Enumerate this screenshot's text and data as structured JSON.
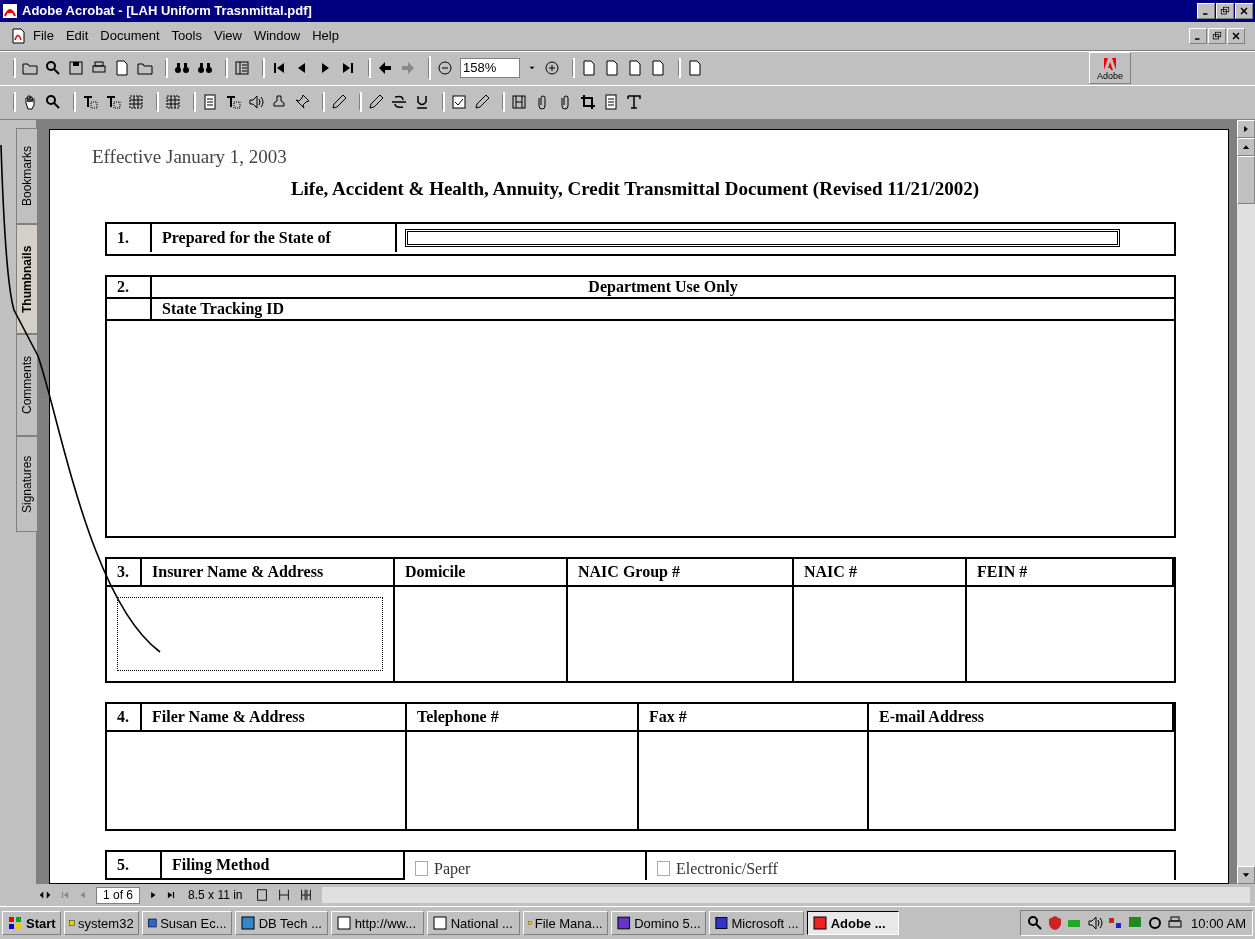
{
  "window": {
    "title": "Adobe Acrobat - [LAH Uniform Trasnmittal.pdf]"
  },
  "menu": [
    "File",
    "Edit",
    "Document",
    "Tools",
    "View",
    "Window",
    "Help"
  ],
  "toolbar": {
    "zoom": "158%",
    "logo_text": "Adobe"
  },
  "side_tabs": [
    {
      "label": "Bookmarks",
      "selected": false
    },
    {
      "label": "Thumbnails",
      "selected": true
    },
    {
      "label": "Comments",
      "selected": false
    },
    {
      "label": "Signatures",
      "selected": false
    }
  ],
  "document": {
    "effective": "Effective January 1, 2003",
    "title": "Life, Accident & Health, Annuity, Credit Transmittal Document (Revised 11/21/2002)",
    "sections": [
      {
        "kind": "field",
        "number": "1.",
        "label": "Prepared for the State of"
      },
      {
        "kind": "department",
        "number": "2.",
        "header": "Department Use Only",
        "label": "State Tracking ID"
      },
      {
        "kind": "columns",
        "number": "3.",
        "columns": [
          "Insurer Name & Address",
          "Domicile",
          "NAIC Group #",
          "NAIC #",
          "FEIN #"
        ]
      },
      {
        "kind": "columns",
        "number": "4.",
        "columns": [
          "Filer Name & Address",
          "Telephone #",
          "Fax #",
          "E-mail Address"
        ]
      },
      {
        "kind": "options",
        "number": "5.",
        "label": "Filing Method",
        "options": [
          {
            "label": "Paper",
            "checked": false
          },
          {
            "label": "Electronic/Serff",
            "checked": false
          }
        ]
      }
    ]
  },
  "status_bar": {
    "page": "1 of 6",
    "page_size": "8.5 x 11 in"
  },
  "taskbar": {
    "start": "Start",
    "items": [
      {
        "label": "system32",
        "selected": false
      },
      {
        "label": "Susan Ec...",
        "selected": false
      },
      {
        "label": "DB Tech ...",
        "selected": false
      },
      {
        "label": "http://ww...",
        "selected": false
      },
      {
        "label": "National ...",
        "selected": false
      },
      {
        "label": "File Mana...",
        "selected": false
      },
      {
        "label": "Domino 5...",
        "selected": false
      },
      {
        "label": "Microsoft ...",
        "selected": false
      },
      {
        "label": "Adobe ...",
        "selected": true
      }
    ],
    "clock": "10:00 AM"
  }
}
